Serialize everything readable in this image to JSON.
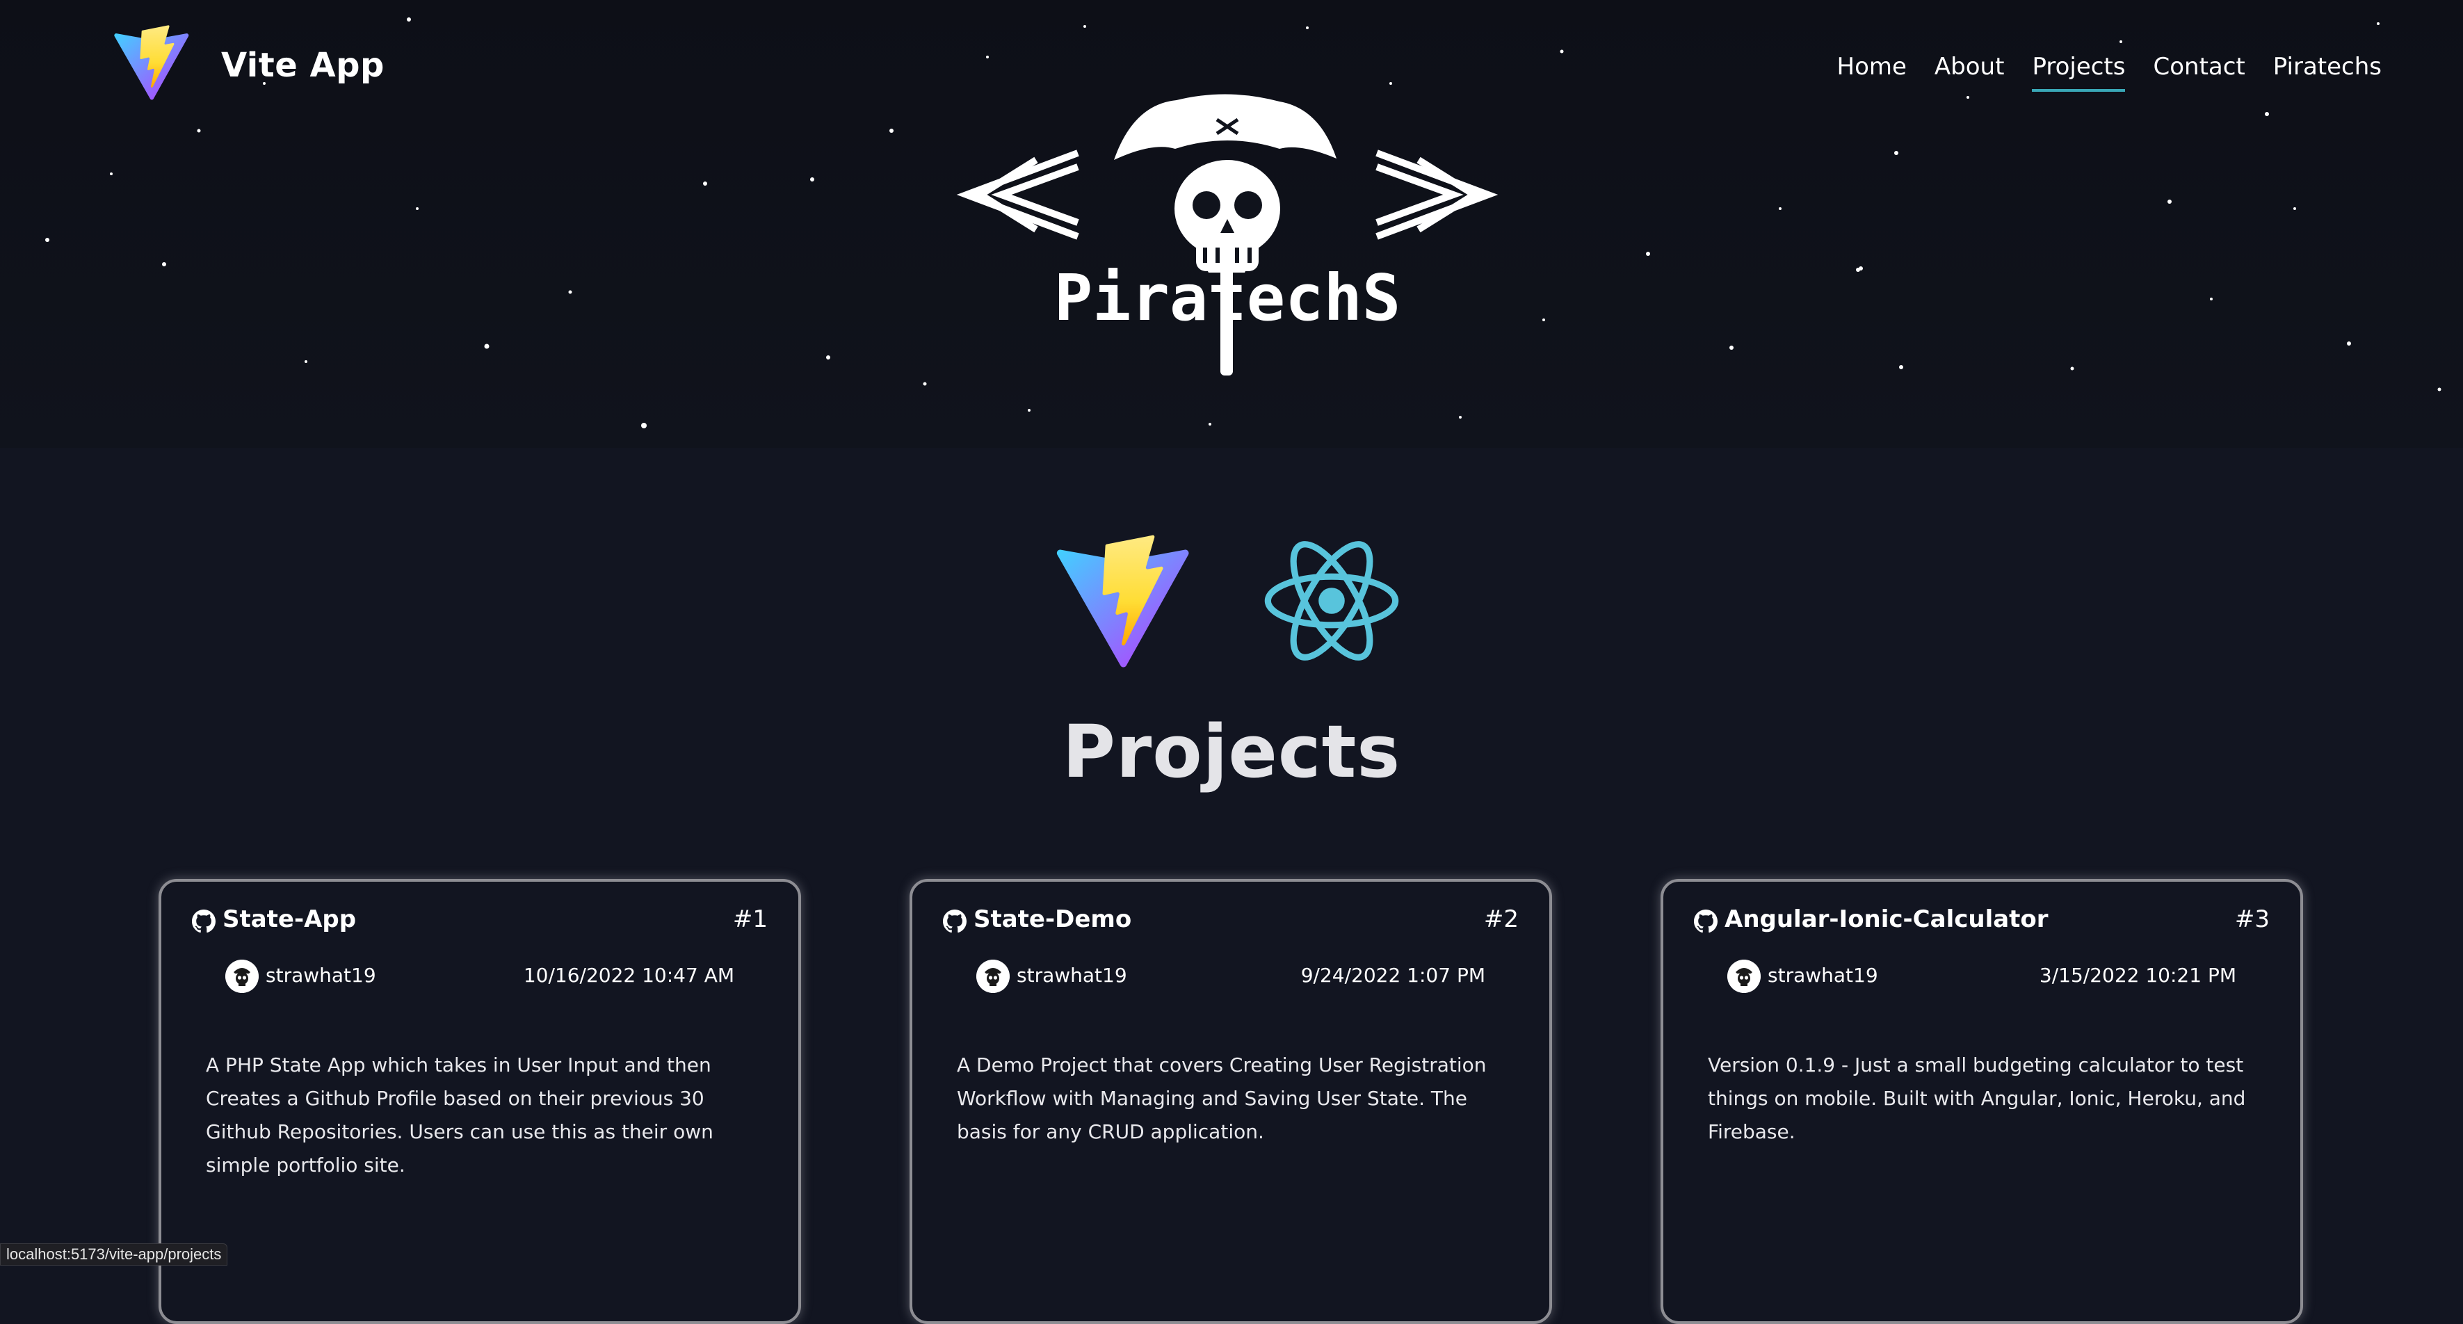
{
  "header": {
    "app_title": "Vite App",
    "nav": [
      {
        "label": "Home",
        "active": false
      },
      {
        "label": "About",
        "active": false
      },
      {
        "label": "Projects",
        "active": true
      },
      {
        "label": "Contact",
        "active": false
      },
      {
        "label": "Piratechs",
        "active": false
      }
    ],
    "hero_logo_text": "PiratechS"
  },
  "main": {
    "title": "Projects",
    "tech_icons": [
      "vite-logo-icon",
      "react-logo-icon"
    ],
    "projects": [
      {
        "name": "State-App",
        "number": "#1",
        "author": "strawhat19",
        "date": "10/16/2022 10:47 AM",
        "description": "A PHP State App which takes in User Input and then Creates a Github Profile based on their previous 30 Github Repositories. Users can use this as their own simple portfolio site."
      },
      {
        "name": "State-Demo",
        "number": "#2",
        "author": "strawhat19",
        "date": "9/24/2022 1:07 PM",
        "description": "A Demo Project that covers Creating User Registration Workflow with Managing and Saving User State. The basis for any CRUD application."
      },
      {
        "name": "Angular-Ionic-Calculator",
        "number": "#3",
        "author": "strawhat19",
        "date": "3/15/2022 10:21 PM",
        "description": "Version 0.1.9 - Just a small budgeting calculator to test things on mobile. Built with Angular, Ionic, Heroku, and Firebase."
      }
    ]
  },
  "status_bar": {
    "url": "localhost:5173/vite-app/projects"
  },
  "colors": {
    "background": "#121521",
    "active_underline": "#39a7b6",
    "react_blue": "#58c4dc",
    "card_border": "#8d8d93"
  }
}
